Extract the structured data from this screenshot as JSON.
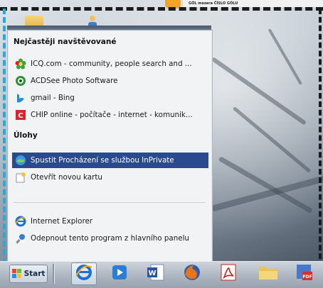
{
  "banner": {
    "text": "GÓL mezera ČÍSLO GÓLU"
  },
  "start_menu": {
    "frequent_title": "Nejčastěji navštěvované",
    "frequent_items": [
      {
        "label": "ICQ.com - community, people search and ...",
        "icon": "icq-flower-icon"
      },
      {
        "label": "ACDSee Photo Software",
        "icon": "acdsee-icon"
      },
      {
        "label": "gmail - Bing",
        "icon": "bing-icon"
      },
      {
        "label": "CHIP online - počítače - internet - komunik...",
        "icon": "chip-icon"
      }
    ],
    "tasks_title": "Úlohy",
    "task_items": [
      {
        "label": "Spustit Procházení se službou InPrivate",
        "icon": "inprivate-icon",
        "highlighted": true
      },
      {
        "label": "Otevřít novou kartu",
        "icon": "new-tab-icon"
      }
    ],
    "pinned_items": [
      {
        "label": "Internet Explorer",
        "icon": "internet-explorer-icon"
      },
      {
        "label": "Odepnout tento program z hlavního panelu",
        "icon": "unpin-icon"
      }
    ]
  },
  "taskbar": {
    "start_label": "Start",
    "icons": [
      "internet-explorer-icon",
      "media-center-icon",
      "word-icon",
      "firefox-icon",
      "acrobat-icon",
      "folder-icon",
      "pdf-converter-icon"
    ]
  },
  "colors": {
    "highlight": "#294a8f",
    "taskbar": "#aab3be",
    "dashed_accent": "#29a9d6"
  }
}
